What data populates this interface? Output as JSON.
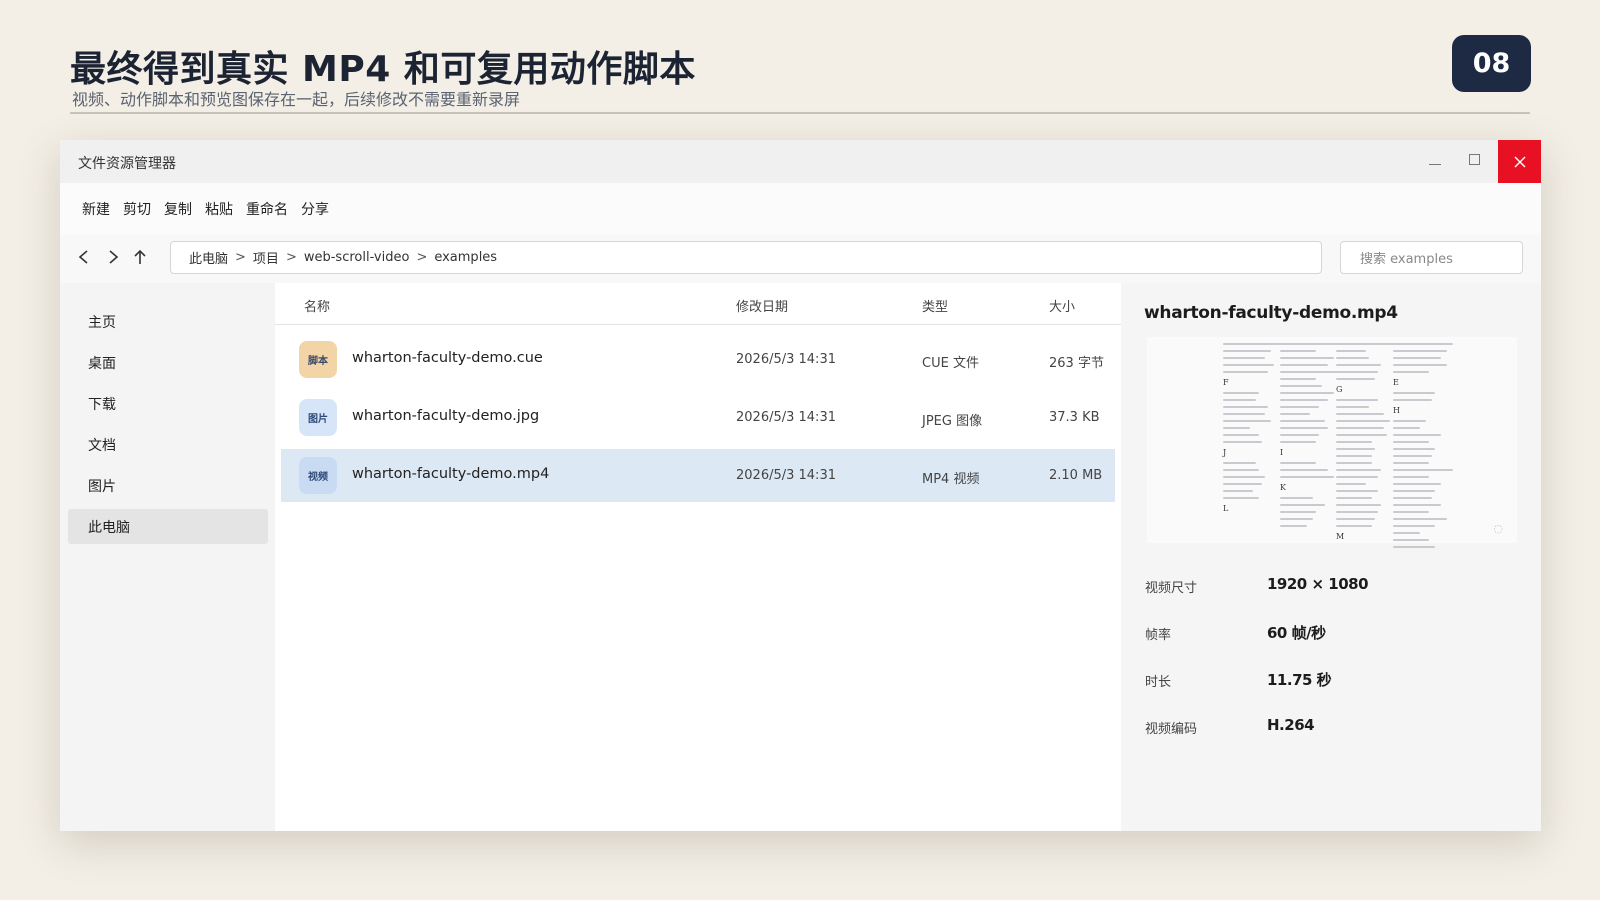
{
  "slide": {
    "title": "最终得到真实 MP4 和可复用动作脚本",
    "subtitle": "视频、动作脚本和预览图保存在一起，后续修改不需要重新录屏",
    "page_number": "08"
  },
  "window": {
    "title": "文件资源管理器",
    "close_color": "#e81123"
  },
  "toolbar": {
    "items": [
      "新建",
      "剪切",
      "复制",
      "粘贴",
      "重命名",
      "分享"
    ]
  },
  "nav": {
    "back": "<",
    "forward": ">",
    "up": "↑",
    "breadcrumb": [
      "此电脑",
      "项目",
      "web-scroll-video",
      "examples"
    ],
    "separator": ">",
    "search_placeholder": "搜索 examples"
  },
  "sidebar": {
    "items": [
      "主页",
      "桌面",
      "下载",
      "文档",
      "图片",
      "此电脑"
    ],
    "active": "此电脑"
  },
  "files": {
    "columns": [
      "名称",
      "修改日期",
      "类型",
      "大小"
    ],
    "rows": [
      {
        "icon": "script-file-icon",
        "badge": "脚本",
        "name": "wharton-faculty-demo.cue",
        "date": "2026/5/3  14:31",
        "type": "CUE 文件",
        "size": "263 字节"
      },
      {
        "icon": "image-file-icon",
        "badge": "图片",
        "name": "wharton-faculty-demo.jpg",
        "date": "2026/5/3  14:31",
        "type": "JPEG 图像",
        "size": "37.3 KB"
      },
      {
        "icon": "video-file-icon",
        "badge": "视频",
        "name": "wharton-faculty-demo.mp4",
        "date": "2026/5/3  14:31",
        "type": "MP4 视频",
        "size": "2.10 MB",
        "selected": true
      }
    ]
  },
  "preview": {
    "filename": "wharton-faculty-demo.mp4",
    "thumb_letters": [
      "F",
      "G",
      "E",
      "H",
      "I",
      "J",
      "K",
      "L",
      "M"
    ],
    "meta": [
      {
        "label": "视频尺寸",
        "value": "1920 × 1080"
      },
      {
        "label": "帧率",
        "value": "60 帧/秒"
      },
      {
        "label": "时长",
        "value": "11.75 秒"
      },
      {
        "label": "视频编码",
        "value": "H.264"
      }
    ]
  },
  "colors": {
    "background": "#f3efe6",
    "title": "#1c2333",
    "badge_bg": "#1e2a44",
    "selection": "#dde8f5"
  }
}
